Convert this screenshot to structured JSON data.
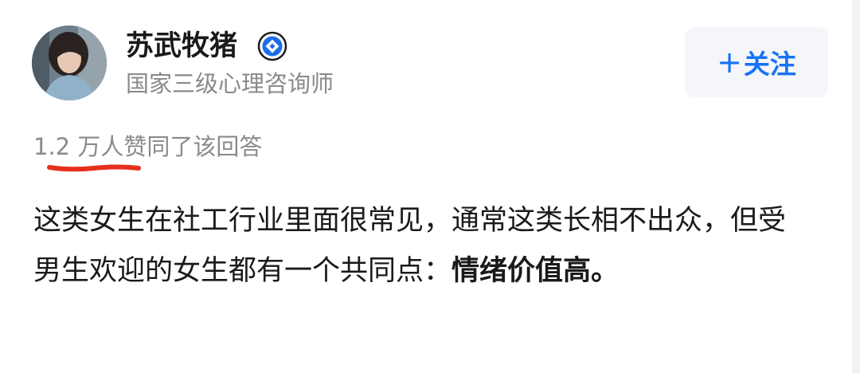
{
  "author": {
    "name": "苏武牧猪",
    "title": "国家三级心理咨询师",
    "avatar_icon": "user-avatar-photo",
    "badge_icon": "verified-badge-icon"
  },
  "follow_button": {
    "icon": "plus-icon",
    "plus": "+",
    "label": "关注",
    "color": "#1772f6"
  },
  "upvote": {
    "text": "1.2 万人赞同了该回答",
    "underline_color": "#e62f1e"
  },
  "answer": {
    "text_normal": "这类女生在社工行业里面很常见，通常这类长相不出众，但受男生欢迎的女生都有一个共同点：",
    "text_bold": "情绪价值高",
    "text_end": "。"
  }
}
